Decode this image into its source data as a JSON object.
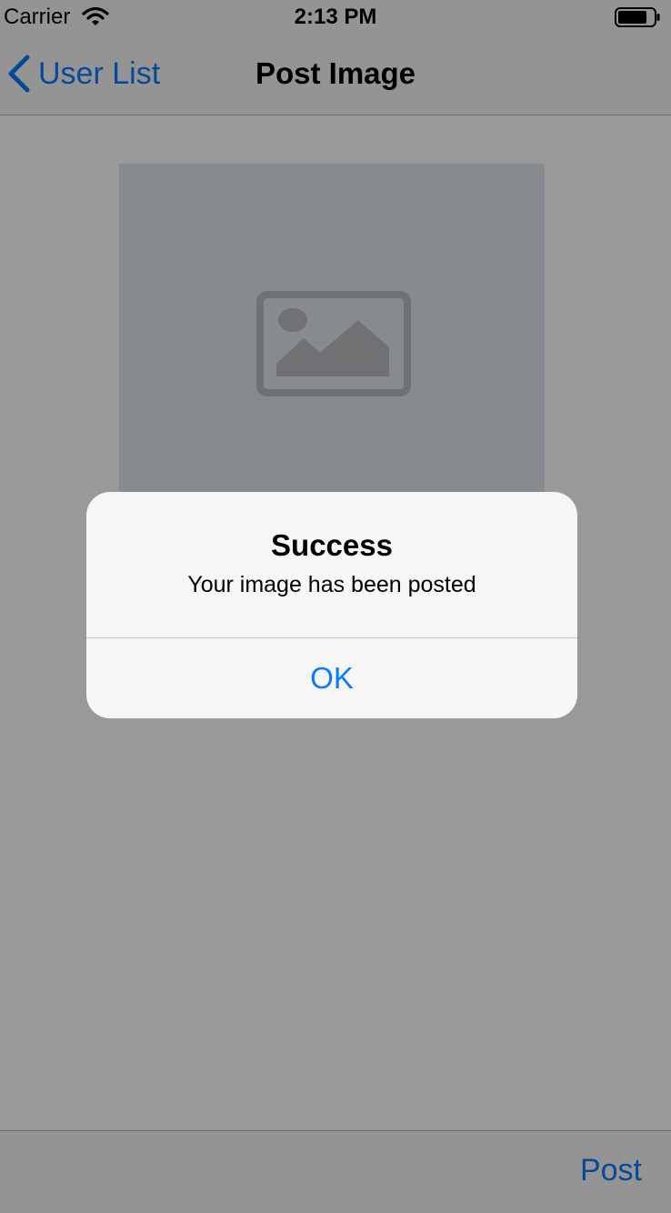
{
  "status_bar": {
    "carrier": "Carrier",
    "time": "2:13 PM",
    "icons": [
      "wifi-icon",
      "battery-icon"
    ]
  },
  "nav_bar": {
    "back_label": "User List",
    "title": "Post Image"
  },
  "content": {
    "image_placeholder_icon": "image-placeholder-icon"
  },
  "toolbar": {
    "post_label": "Post"
  },
  "alert": {
    "title": "Success",
    "message": "Your image has been posted",
    "ok_label": "OK"
  },
  "colors": {
    "accent": "#0a7aff",
    "bar_background": "#f7f7f7",
    "placeholder_background": "#e2e8ee",
    "overlay": "rgba(0,0,0,0.4)"
  }
}
